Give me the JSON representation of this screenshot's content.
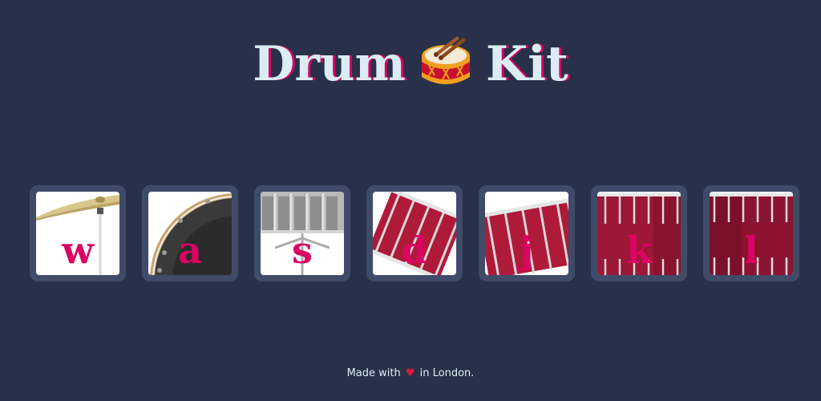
{
  "header": {
    "title_left": "Drum",
    "title_right": "Kit"
  },
  "keys": [
    {
      "letter": "w",
      "drum": "crash"
    },
    {
      "letter": "a",
      "drum": "kick-bass"
    },
    {
      "letter": "s",
      "drum": "snare"
    },
    {
      "letter": "d",
      "drum": "tom-1"
    },
    {
      "letter": "j",
      "drum": "tom-2"
    },
    {
      "letter": "k",
      "drum": "tom-3"
    },
    {
      "letter": "l",
      "drum": "tom-4"
    }
  ],
  "footer": {
    "before": "Made with",
    "heart": "♥",
    "after": "in London."
  },
  "colors": {
    "background": "#283149",
    "key_frame": "#404b69",
    "letter": "#da0463",
    "title_text": "#dbedf3",
    "title_shadow": "#da0463"
  }
}
